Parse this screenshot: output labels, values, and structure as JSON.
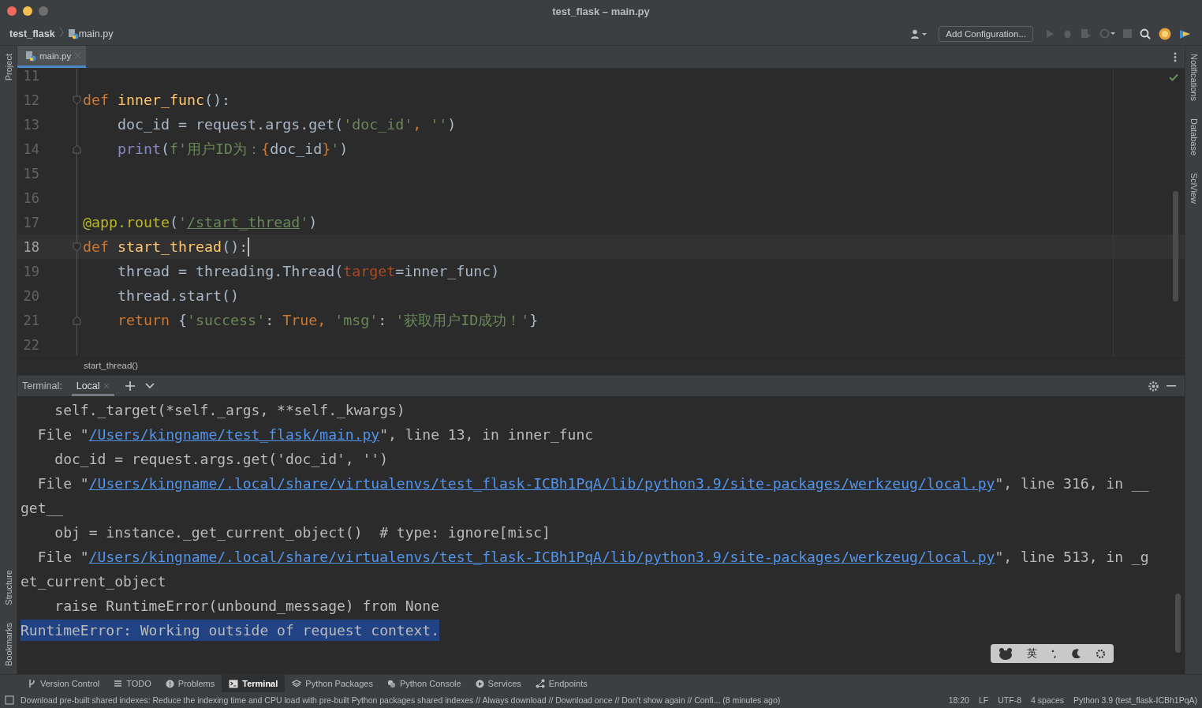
{
  "window": {
    "title": "test_flask – main.py"
  },
  "navbar": {
    "breadcrumbs": [
      "test_flask",
      "main.py"
    ],
    "run_config": "Add Configuration..."
  },
  "left_tools_top": [
    "Project"
  ],
  "left_tools_bottom": [
    "Structure",
    "Bookmarks"
  ],
  "right_tools": [
    "Notifications",
    "Database",
    "SciView"
  ],
  "editor_tabs": [
    {
      "label": "main.py",
      "selected": true
    }
  ],
  "editor": {
    "lines": [
      {
        "number": "11",
        "current": false,
        "fold_start": false,
        "fold_end": false
      },
      {
        "number": "12",
        "current": false,
        "fold_start": true,
        "fold_end": false,
        "tokens": [
          {
            "kind": "kw",
            "text": "def"
          },
          {
            "kind": "fn",
            "text": " inner_func"
          },
          {
            "kind": "plain",
            "text": "():"
          }
        ]
      },
      {
        "number": "13",
        "current": false,
        "fold_start": false,
        "fold_end": false,
        "tokens": [
          {
            "kind": "plain",
            "text": "    doc_id = request.args.get("
          },
          {
            "kind": "str",
            "text": "'doc_id'"
          },
          {
            "kind": "kw",
            "text": ", "
          },
          {
            "kind": "str",
            "text": "''"
          },
          {
            "kind": "plain",
            "text": ")"
          }
        ]
      },
      {
        "number": "14",
        "current": false,
        "fold_start": false,
        "fold_end": true,
        "tokens": [
          {
            "kind": "builtin",
            "text": "    print"
          },
          {
            "kind": "plain",
            "text": "("
          },
          {
            "kind": "str",
            "text": "f'用户ID为："
          },
          {
            "kind": "kw",
            "text": "{"
          },
          {
            "kind": "plain",
            "text": "doc_id"
          },
          {
            "kind": "kw",
            "text": "}"
          },
          {
            "kind": "str",
            "text": "'"
          },
          {
            "kind": "plain",
            "text": ")"
          }
        ]
      },
      {
        "number": "15",
        "current": false,
        "fold_start": false,
        "fold_end": false
      },
      {
        "number": "16",
        "current": false,
        "fold_start": false,
        "fold_end": false
      },
      {
        "number": "17",
        "current": false,
        "fold_start": false,
        "fold_end": false,
        "tokens": [
          {
            "kind": "deco",
            "text": "@app.route"
          },
          {
            "kind": "plain",
            "text": "("
          },
          {
            "kind": "str",
            "text": "'"
          },
          {
            "kind": "link",
            "text": "/start_thread"
          },
          {
            "kind": "str",
            "text": "'"
          },
          {
            "kind": "plain",
            "text": ")"
          }
        ]
      },
      {
        "number": "18",
        "current": true,
        "fold_start": true,
        "fold_end": false,
        "tokens": [
          {
            "kind": "kw",
            "text": "def"
          },
          {
            "kind": "fn",
            "text": " start_thread"
          },
          {
            "kind": "plain",
            "text": "():"
          }
        ]
      },
      {
        "number": "19",
        "current": false,
        "fold_start": false,
        "fold_end": false,
        "tokens": [
          {
            "kind": "plain",
            "text": "    thread = threading.Thread("
          },
          {
            "kind": "param",
            "text": "target"
          },
          {
            "kind": "plain",
            "text": "=inner_func)"
          }
        ]
      },
      {
        "number": "20",
        "current": false,
        "fold_start": false,
        "fold_end": false,
        "tokens": [
          {
            "kind": "plain",
            "text": "    thread.start()"
          }
        ]
      },
      {
        "number": "21",
        "current": false,
        "fold_start": false,
        "fold_end": true,
        "tokens": [
          {
            "kind": "kw",
            "text": "    return"
          },
          {
            "kind": "plain",
            "text": " {"
          },
          {
            "kind": "str",
            "text": "'success'"
          },
          {
            "kind": "plain",
            "text": ": "
          },
          {
            "kind": "kw",
            "text": "True, "
          },
          {
            "kind": "str",
            "text": "'msg'"
          },
          {
            "kind": "plain",
            "text": ": "
          },
          {
            "kind": "str",
            "text": "'获取用户ID成功！'"
          },
          {
            "kind": "plain",
            "text": "}"
          }
        ]
      },
      {
        "number": "22",
        "current": false,
        "fold_start": false,
        "fold_end": false
      }
    ]
  },
  "breadcrumb": "start_thread()",
  "terminal": {
    "label": "Terminal:",
    "tabs": [
      {
        "label": "Local",
        "selected": true
      }
    ],
    "lines": [
      {
        "selected": false,
        "tokens": [
          {
            "kind": "plain",
            "text": "    self._target(*self._args, **self._kwargs)"
          }
        ]
      },
      {
        "selected": false,
        "tokens": [
          {
            "kind": "plain",
            "text": "  File \""
          },
          {
            "kind": "link",
            "text": "/Users/kingname/test_flask/main.py"
          },
          {
            "kind": "plain",
            "text": "\", line 13, in inner_func"
          }
        ]
      },
      {
        "selected": false,
        "tokens": [
          {
            "kind": "plain",
            "text": "    doc_id = request.args.get('doc_id', '')"
          }
        ]
      },
      {
        "selected": false,
        "tokens": [
          {
            "kind": "plain",
            "text": "  File \""
          },
          {
            "kind": "link",
            "text": "/Users/kingname/.local/share/virtualenvs/test_flask-ICBh1PqA/lib/python3.9/site-packages/werkzeug/local.py"
          },
          {
            "kind": "plain",
            "text": "\", line 316, in __"
          }
        ]
      },
      {
        "selected": false,
        "tokens": [
          {
            "kind": "plain",
            "text": "get__"
          }
        ]
      },
      {
        "selected": false,
        "tokens": [
          {
            "kind": "plain",
            "text": "    obj = instance._get_current_object()  # type: ignore[misc]"
          }
        ]
      },
      {
        "selected": false,
        "tokens": [
          {
            "kind": "plain",
            "text": "  File \""
          },
          {
            "kind": "link",
            "text": "/Users/kingname/.local/share/virtualenvs/test_flask-ICBh1PqA/lib/python3.9/site-packages/werkzeug/local.py"
          },
          {
            "kind": "plain",
            "text": "\", line 513, in _g"
          }
        ]
      },
      {
        "selected": false,
        "tokens": [
          {
            "kind": "plain",
            "text": "et_current_object"
          }
        ]
      },
      {
        "selected": false,
        "tokens": [
          {
            "kind": "plain",
            "text": "    raise RuntimeError(unbound_message) from None"
          }
        ]
      },
      {
        "selected": true,
        "tokens": [
          {
            "kind": "plain",
            "text": "RuntimeError: Working outside of request context."
          }
        ]
      }
    ]
  },
  "ime_bar": {
    "label": "英"
  },
  "tool_windows": [
    {
      "kind": "vcs",
      "label": "Version Control",
      "selected": false
    },
    {
      "kind": "list",
      "label": "TODO",
      "selected": false
    },
    {
      "kind": "problems",
      "label": "Problems",
      "selected": false
    },
    {
      "kind": "terminal",
      "label": "Terminal",
      "selected": true
    },
    {
      "kind": "packages",
      "label": "Python Packages",
      "selected": false
    },
    {
      "kind": "console",
      "label": "Python Console",
      "selected": false
    },
    {
      "kind": "services",
      "label": "Services",
      "selected": false
    },
    {
      "kind": "endpoints",
      "label": "Endpoints",
      "selected": false
    }
  ],
  "status_bar": {
    "message": "Download pre-built shared indexes: Reduce the indexing time and CPU load with pre-built Python packages shared indexes // Always download // Download once // Don't show again // Confi... (8 minutes ago)",
    "items": [
      "18:20",
      "LF",
      "UTF-8",
      "4 spaces",
      "Python 3.9 (test_flask-ICBh1PqA)"
    ]
  }
}
